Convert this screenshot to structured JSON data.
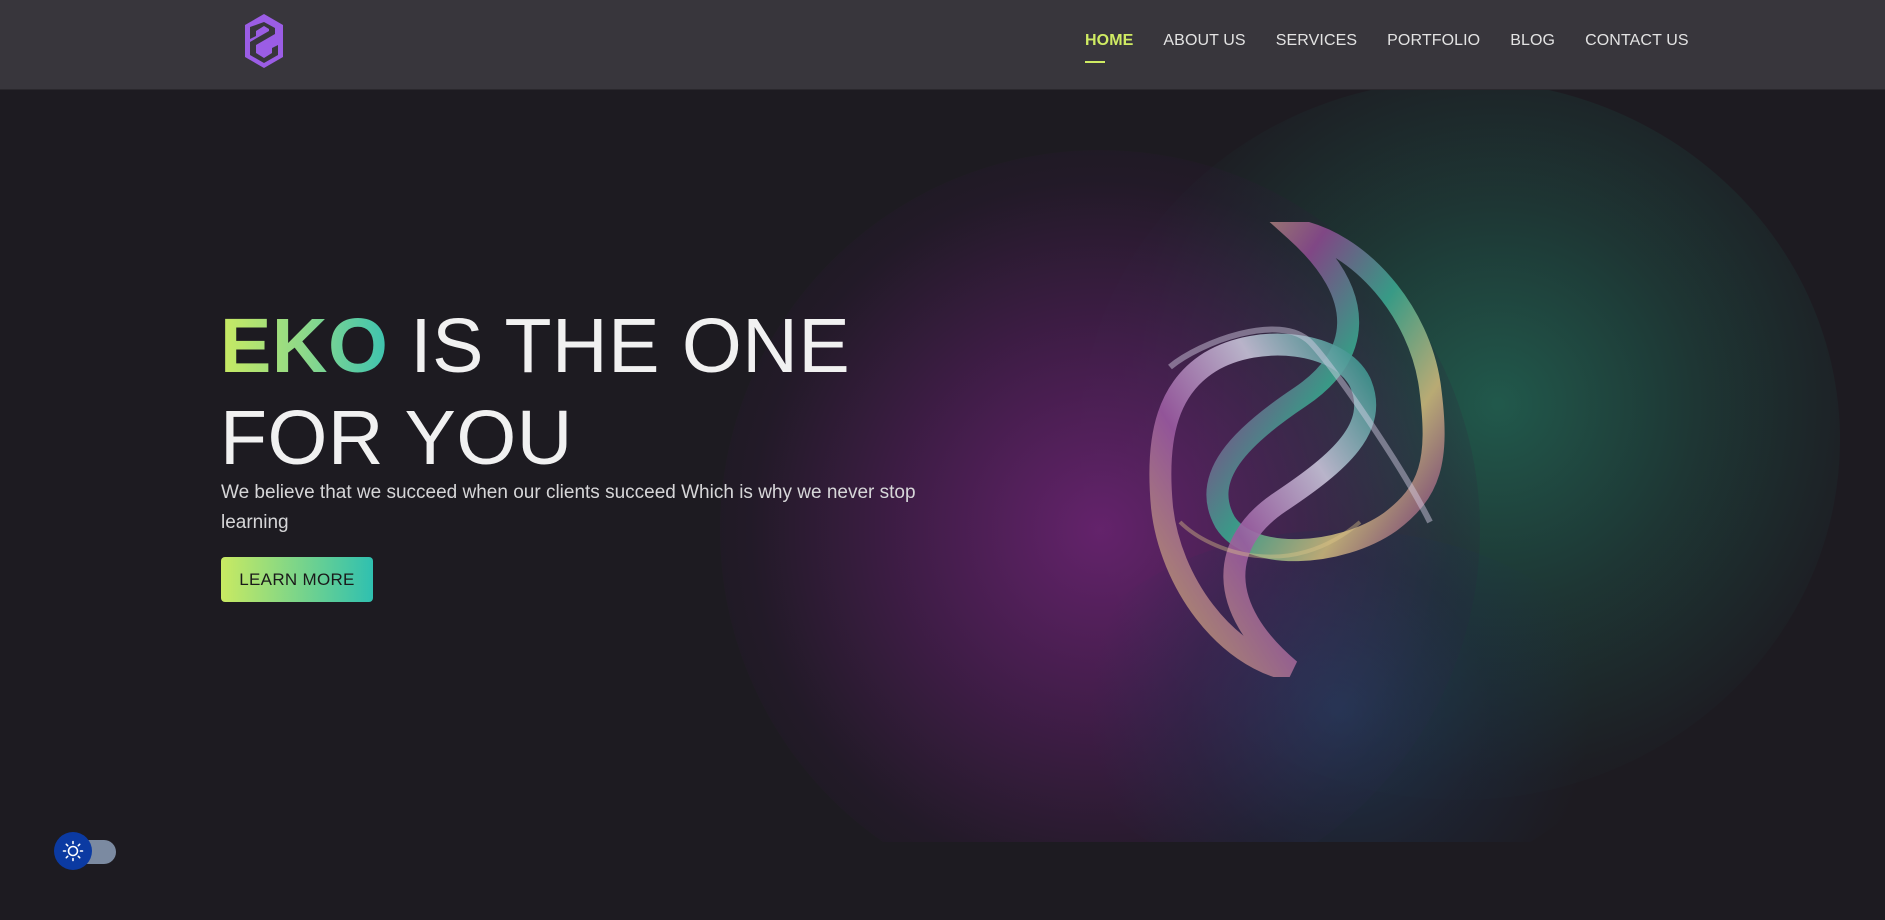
{
  "header": {
    "logo_icon": "eko-hexagon-logo-icon",
    "nav": [
      {
        "label": "HOME",
        "active": true
      },
      {
        "label": "ABOUT US",
        "active": false
      },
      {
        "label": "SERVICES",
        "active": false
      },
      {
        "label": "PORTFOLIO",
        "active": false
      },
      {
        "label": "BLOG",
        "active": false
      },
      {
        "label": "CONTACT US",
        "active": false
      }
    ]
  },
  "hero": {
    "brand": "EKO",
    "title_rest": "IS THE ONE FOR YOU",
    "subtitle": "We believe that we succeed when our clients succeed Which is why we never stop learning",
    "cta_label": "LEARN MORE",
    "image_icon": "twisted-ring-sculpture-image"
  },
  "theme_toggle": {
    "icon": "sun-icon"
  },
  "colors": {
    "accent_green": "#cfeb63",
    "accent_teal": "#2fc0b0",
    "logo_purple": "#9b5de5",
    "toggle_blue": "#0b3aa2",
    "background": "#1d1b21",
    "navbar": "#38363c"
  }
}
